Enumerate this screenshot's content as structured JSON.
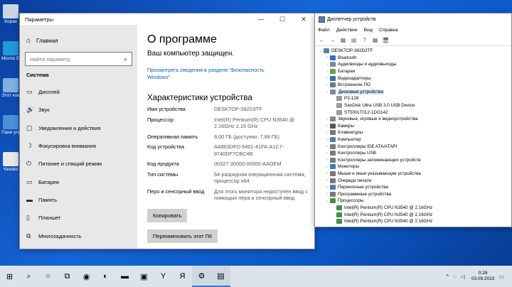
{
  "desktop": {
    "icons": [
      {
        "label": "Корзи",
        "color": "#c9d6e3"
      },
      {
        "label": "Micros Edge",
        "color": "#1f9bd8"
      },
      {
        "label": "Этот компьют",
        "color": "#7fb0e0"
      },
      {
        "label": "Пане управле",
        "color": "#4a90d9"
      },
      {
        "label": "Yandex",
        "color": "#e8e8e8"
      }
    ]
  },
  "settings": {
    "title": "Параметры",
    "caption_buttons": {
      "minimize": "—",
      "maximize": "☐",
      "close": "✕"
    },
    "nav": {
      "home": "Главная",
      "search_placeholder": "Найти параметр",
      "section": "Система",
      "items": [
        {
          "label": "Дисплей",
          "icon": "▭"
        },
        {
          "label": "Звук",
          "icon": "🔊"
        },
        {
          "label": "Уведомления и действия",
          "icon": "▢"
        },
        {
          "label": "Фокусировка внимания",
          "icon": "☽"
        },
        {
          "label": "Питание и спящий режим",
          "icon": "⏻"
        },
        {
          "label": "Батарея",
          "icon": "▭"
        },
        {
          "label": "Память",
          "icon": "▬"
        },
        {
          "label": "Планшет",
          "icon": "▯"
        },
        {
          "label": "Многозадачность",
          "icon": "⧉"
        }
      ]
    },
    "content": {
      "title": "О программе",
      "protected": "Ваш компьютер защищен.",
      "security_link": "Просмотреть сведения в разделе \"Безопасность Windows\"",
      "specs_title": "Характеристики устройства",
      "specs": [
        {
          "key": "Имя устройства",
          "value": "DESKTOP-392D3TF"
        },
        {
          "key": "Процессор",
          "value": "Intel(R) Pentium(R) CPU  N3540  @ 2.16GHz   2.16 GHz"
        },
        {
          "key": "Оперативная память",
          "value": "8,00 ГБ (доступно: 7,88 ГБ)"
        },
        {
          "key": "Код устройства",
          "value": "AA863DFD-5401-41FA-A1C7-9740DF7CBC4B"
        },
        {
          "key": "Код продукта",
          "value": "00327-30000-00000-AAOEM"
        },
        {
          "key": "Тип системы",
          "value": "64-разрядная операционная система, процессор x64"
        },
        {
          "key": "Перо и сенсорный ввод",
          "value": "Для этого монитора недоступен ввод с помощью пера и сенсорный ввод"
        }
      ],
      "copy_button": "Копировать",
      "rename_button": "Переименовать этот ПК"
    }
  },
  "devmgr": {
    "title": "Диспетчер устройств",
    "menu": [
      "Файл",
      "Действие",
      "Вид",
      "Справка"
    ],
    "toolbar": [
      "←",
      "→",
      "▦",
      "▤",
      "?",
      "▦",
      "🖥"
    ],
    "tree": [
      {
        "label": "DESKTOP-392D3TF",
        "level": 0,
        "toggle": "⌄",
        "color": "#5a7fa8"
      },
      {
        "label": "Bluetooth",
        "level": 1,
        "toggle": "›",
        "color": "#2a6fd0"
      },
      {
        "label": "Аудиовходы и аудиовыходы",
        "level": 1,
        "toggle": "›",
        "color": "#7a8a99"
      },
      {
        "label": "Батареи",
        "level": 1,
        "toggle": "›",
        "color": "#5ea34a"
      },
      {
        "label": "Видеоадаптеры",
        "level": 1,
        "toggle": "›",
        "color": "#3c6fa8"
      },
      {
        "label": "Встроенное ПО",
        "level": 1,
        "toggle": "›",
        "color": "#6a7a8a"
      },
      {
        "label": "Дисковые устройства",
        "level": 1,
        "toggle": "⌄",
        "color": "#888888",
        "selected": true
      },
      {
        "label": "P3-128",
        "level": 2,
        "toggle": "",
        "color": "#999999"
      },
      {
        "label": "SanDisk Ultra USB 3.0 USB Device",
        "level": 2,
        "toggle": "",
        "color": "#999999"
      },
      {
        "label": "ST500LT012-1DG142",
        "level": 2,
        "toggle": "",
        "color": "#999999"
      },
      {
        "label": "Звуковые, игровые и видеоустройства",
        "level": 1,
        "toggle": "›",
        "color": "#7a8a99"
      },
      {
        "label": "Камеры",
        "level": 1,
        "toggle": "›",
        "color": "#555555"
      },
      {
        "label": "Клавиатуры",
        "level": 1,
        "toggle": "›",
        "color": "#777777"
      },
      {
        "label": "Компьютер",
        "level": 1,
        "toggle": "›",
        "color": "#4a7ab8"
      },
      {
        "label": "Контроллеры IDE ATA/ATAPI",
        "level": 1,
        "toggle": "›",
        "color": "#7a7a7a"
      },
      {
        "label": "Контроллеры USB",
        "level": 1,
        "toggle": "›",
        "color": "#7a7a7a"
      },
      {
        "label": "Контроллеры запоминающих устройств",
        "level": 1,
        "toggle": "›",
        "color": "#7a7a7a"
      },
      {
        "label": "Мониторы",
        "level": 1,
        "toggle": "›",
        "color": "#3a7ac8"
      },
      {
        "label": "Мыши и иные указывающие устройства",
        "level": 1,
        "toggle": "›",
        "color": "#777777"
      },
      {
        "label": "Очереди печати",
        "level": 1,
        "toggle": "›",
        "color": "#777777"
      },
      {
        "label": "Переносные устройства",
        "level": 1,
        "toggle": "›",
        "color": "#4a7ab8"
      },
      {
        "label": "Программные устройства",
        "level": 1,
        "toggle": "›",
        "color": "#777777"
      },
      {
        "label": "Процессоры",
        "level": 1,
        "toggle": "⌄",
        "color": "#4a8a4a"
      },
      {
        "label": "Intel(R) Pentium(R) CPU  N3540  @ 2.16GHz",
        "level": 2,
        "toggle": "",
        "color": "#4a8a4a"
      },
      {
        "label": "Intel(R) Pentium(R) CPU  N3540  @ 2.16GHz",
        "level": 2,
        "toggle": "",
        "color": "#4a8a4a"
      },
      {
        "label": "Intel(R) Pentium(R) CPU  N3540  @ 2.16GHz",
        "level": 2,
        "toggle": "",
        "color": "#4a8a4a"
      }
    ]
  },
  "taskbar": {
    "items": [
      {
        "name": "start-button",
        "glyph": "⊞"
      },
      {
        "name": "search-button",
        "glyph": "⌕"
      },
      {
        "name": "cortana-button",
        "glyph": "○"
      },
      {
        "name": "taskview-button",
        "glyph": "⧉"
      },
      {
        "name": "alice-button",
        "glyph": "◉"
      },
      {
        "name": "edge-button",
        "glyph": "◐"
      },
      {
        "name": "explorer-button",
        "glyph": "▬"
      },
      {
        "name": "store-button",
        "glyph": "▣"
      },
      {
        "name": "yandex-button",
        "glyph": "Y"
      },
      {
        "name": "yandex-browser-button",
        "glyph": "Я"
      },
      {
        "name": "settings-button",
        "glyph": "⚙"
      },
      {
        "name": "devmgr-button",
        "glyph": "▤"
      }
    ],
    "tray_arrow": "^",
    "time": "0:28",
    "date": "03.09.2023"
  }
}
